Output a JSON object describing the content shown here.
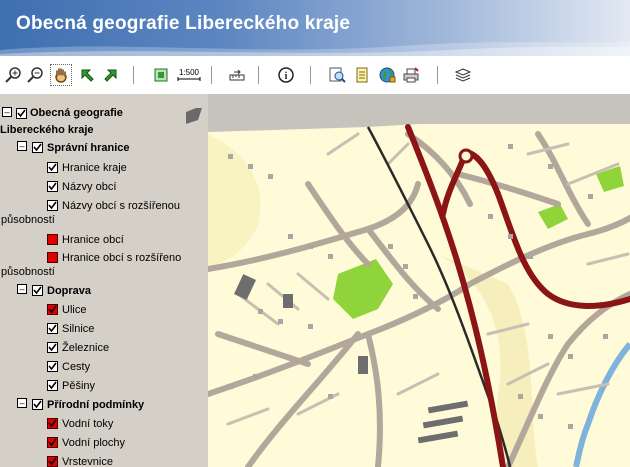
{
  "app": {
    "title": "Obecná geografie Libereckého kraje"
  },
  "toolbar": {
    "icons": [
      "zoom-in-icon",
      "zoom-out-icon",
      "pan-hand-icon",
      "back-arrow-icon",
      "forward-arrow-icon",
      "full-extent-icon",
      "scale-icon",
      "measure-icon",
      "info-icon",
      "search-icon",
      "report-icon",
      "globe-icon",
      "print-icon",
      "layers-icon"
    ],
    "scale_label": "1:500"
  },
  "legend": {
    "root": "Obecná geografie Libereckého kraje",
    "root_line1": "Obecná geografie",
    "root_line2": "Libereckého kraje",
    "groups": [
      {
        "label": "Správní hranice",
        "items": [
          {
            "label": "Hranice kraje",
            "checked": true
          },
          {
            "label": "Názvy obcí",
            "checked": true
          },
          {
            "label": "Názvy obcí s rozšířenou působností",
            "line1": "Názvy obcí s rozšířenou",
            "line2": "působností",
            "checked": true
          },
          {
            "label": "Hranice obcí",
            "checked": false,
            "state": "red"
          },
          {
            "label": "Hranice obcí s rozšířenou působností",
            "line1": "Hranice obcí s rozšířeno",
            "line2": "působností",
            "checked": false,
            "state": "red"
          }
        ]
      },
      {
        "label": "Doprava",
        "items": [
          {
            "label": "Ulice",
            "checked": true,
            "state": "red"
          },
          {
            "label": "Silnice",
            "checked": true
          },
          {
            "label": "Železnice",
            "checked": true
          },
          {
            "label": "Cesty",
            "checked": true
          },
          {
            "label": "Pěšiny",
            "checked": true
          }
        ]
      },
      {
        "label": "Přírodní podmínky",
        "items": [
          {
            "label": "Vodní toky",
            "checked": true,
            "state": "red"
          },
          {
            "label": "Vodní plochy",
            "checked": true,
            "state": "red"
          },
          {
            "label": "Vrstevnice",
            "checked": true,
            "state": "red"
          }
        ]
      }
    ]
  },
  "colors": {
    "header_start": "#3f6fb0",
    "panel": "#d4d0c8",
    "road": "#b3a79b",
    "highway": "#8b1515",
    "park": "#8fd43a",
    "land": "#fffbd8",
    "building": "#6e6e6e",
    "water": "#7fb2dc"
  }
}
